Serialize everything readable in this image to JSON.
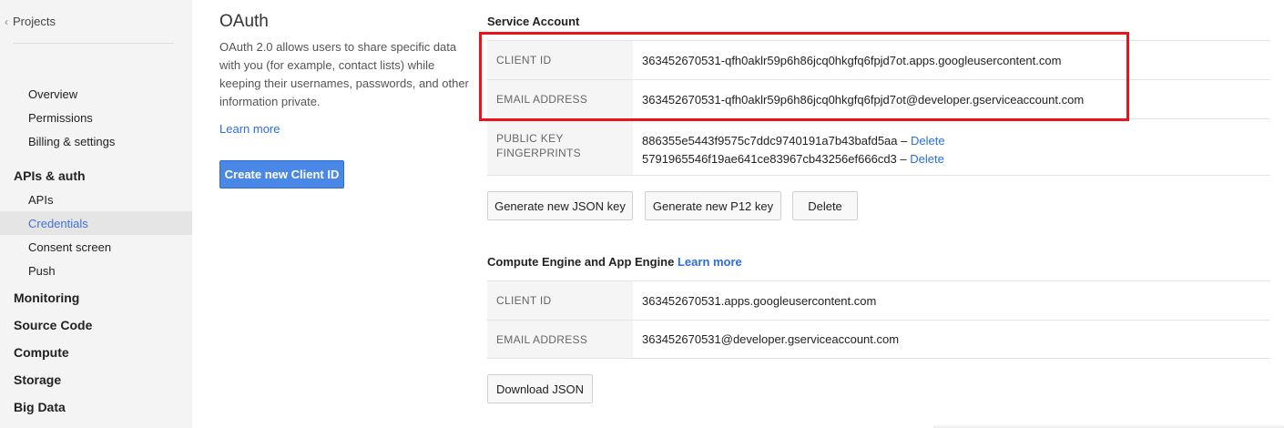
{
  "sidebar": {
    "back_label": "Projects",
    "project_items": [
      "Overview",
      "Permissions",
      "Billing & settings"
    ],
    "apis_heading": "APIs & auth",
    "apis_items": [
      "APIs",
      "Credentials",
      "Consent screen",
      "Push"
    ],
    "active_item": "Credentials",
    "sections": [
      "Monitoring",
      "Source Code",
      "Compute",
      "Storage",
      "Big Data"
    ]
  },
  "oauth": {
    "title": "OAuth",
    "description": "OAuth 2.0 allows users to share specific data with you (for example, contact lists) while keeping their usernames, passwords, and other information private.",
    "learn_more": "Learn more",
    "create_button": "Create new Client ID"
  },
  "service_account": {
    "title": "Service Account",
    "client_id_label": "CLIENT ID",
    "client_id": "363452670531-qfh0aklr59p6h86jcq0hkgfq6fpjd7ot.apps.googleusercontent.com",
    "email_label": "EMAIL ADDRESS",
    "email": "363452670531-qfh0aklr59p6h86jcq0hkgfq6fpjd7ot@developer.gserviceaccount.com",
    "fingerprint_label_line1": "PUBLIC KEY",
    "fingerprint_label_line2": "FINGERPRINTS",
    "fingerprints": [
      {
        "value": "886355e5443f9575c7ddc9740191a7b43bafd5aa",
        "separator": " – ",
        "delete": "Delete"
      },
      {
        "value": "5791965546f19ae641ce83967cb43256ef666cd3",
        "separator": " – ",
        "delete": "Delete"
      }
    ],
    "buttons": {
      "json_key": "Generate new JSON key",
      "p12_key": "Generate new P12 key",
      "delete": "Delete"
    }
  },
  "compute_engine": {
    "title": "Compute Engine and App Engine",
    "learn_more": "Learn more",
    "client_id_label": "CLIENT ID",
    "client_id": "363452670531.apps.googleusercontent.com",
    "email_label": "EMAIL ADDRESS",
    "email": "363452670531@developer.gserviceaccount.com",
    "download_button": "Download JSON"
  },
  "colors": {
    "accent_link": "#2a6ee0",
    "primary_button": "#4a88e8",
    "highlight_border": "#e8141a",
    "sidebar_bg": "#f4f4f4"
  }
}
